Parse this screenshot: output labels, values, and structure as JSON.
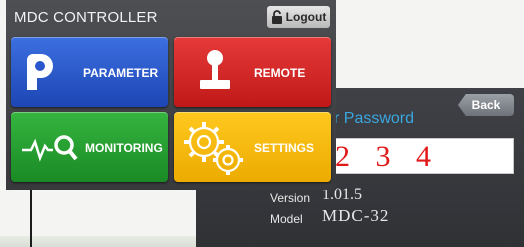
{
  "main": {
    "title": "MDC CONTROLLER",
    "logout_label": "Logout",
    "tiles": [
      {
        "label": "PARAMETER",
        "color": "#1f4fc4",
        "icon": "parameter-p-icon"
      },
      {
        "label": "REMOTE",
        "color": "#d11f1f",
        "icon": "joystick-icon"
      },
      {
        "label": "MONITORING",
        "color": "#1f9e2a",
        "icon": "monitoring-search-icon"
      },
      {
        "label": "SETTINGS",
        "color": "#f4b800",
        "icon": "gears-icon"
      }
    ]
  },
  "password_screen": {
    "back_label": "Back",
    "title_partial": "r Password",
    "password_digits": "2 3 4",
    "version_label": "Version",
    "version_value": "1.01.5",
    "model_label": "Model",
    "model_value": "MDC-32"
  }
}
